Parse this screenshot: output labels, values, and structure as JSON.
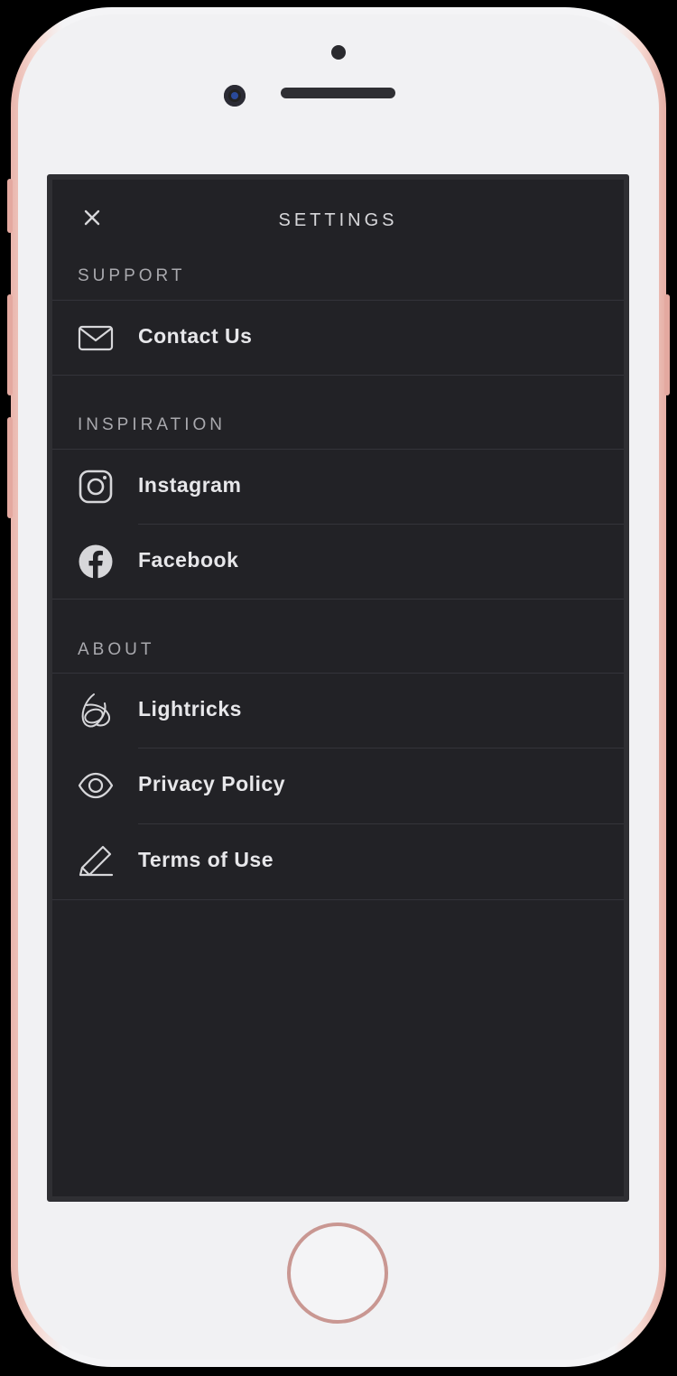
{
  "header": {
    "title": "SETTINGS",
    "close_icon": "close-icon"
  },
  "sections": {
    "support": {
      "label": "SUPPORT",
      "items": [
        {
          "label": "Contact Us",
          "icon": "mail-icon"
        }
      ]
    },
    "inspiration": {
      "label": "INSPIRATION",
      "items": [
        {
          "label": "Instagram",
          "icon": "instagram-icon"
        },
        {
          "label": "Facebook",
          "icon": "facebook-icon"
        }
      ]
    },
    "about": {
      "label": "ABOUT",
      "items": [
        {
          "label": "Lightricks",
          "icon": "lightricks-logo-icon"
        },
        {
          "label": "Privacy Policy",
          "icon": "eye-icon"
        },
        {
          "label": "Terms of Use",
          "icon": "pencil-icon"
        }
      ]
    }
  },
  "colors": {
    "background": "#222226",
    "text": "#e7e7ea",
    "section_label": "#a9a9ae",
    "divider": "#34343a",
    "phone_frame": "#f6d9d2"
  }
}
